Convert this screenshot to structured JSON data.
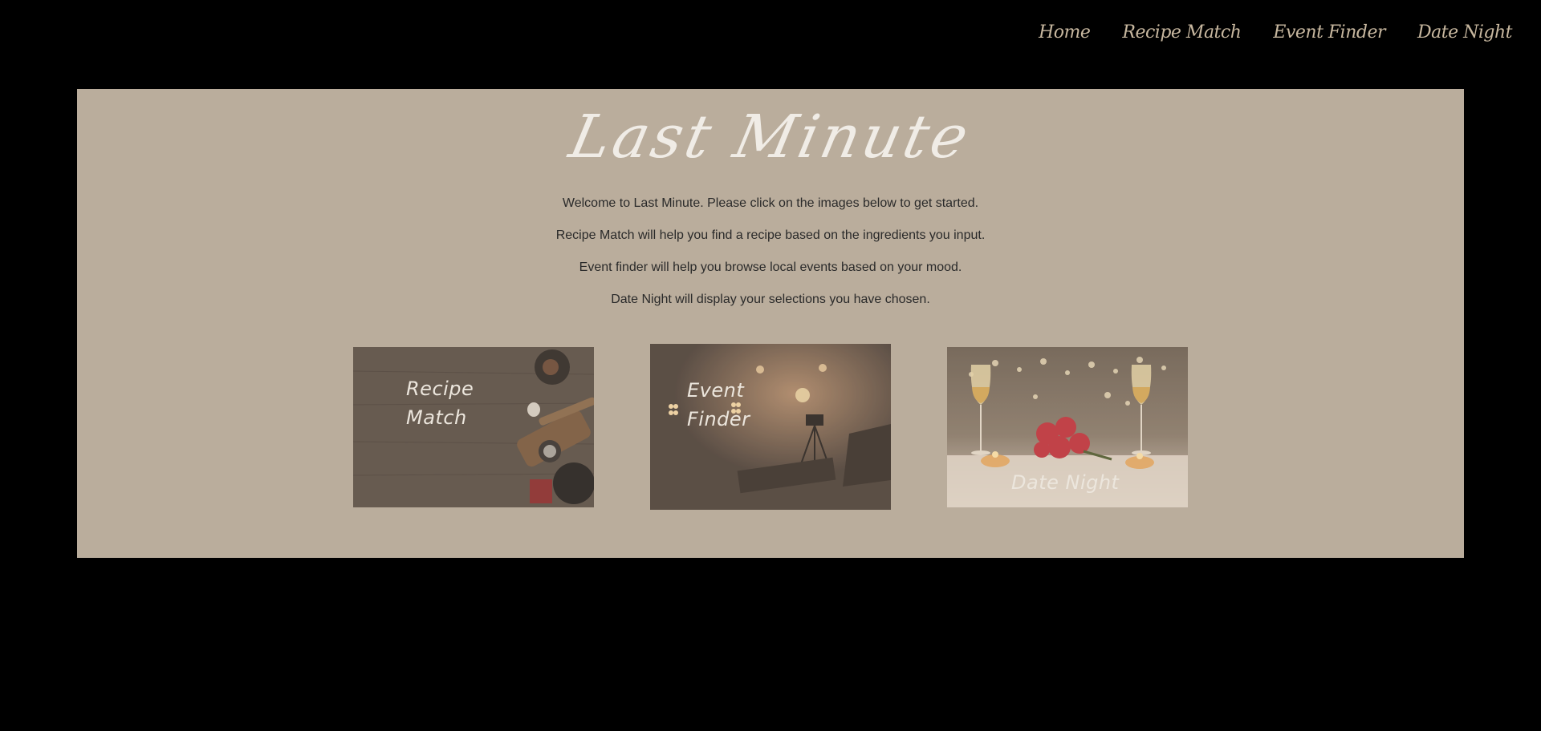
{
  "nav": {
    "items": [
      {
        "label": "Home"
      },
      {
        "label": "Recipe Match"
      },
      {
        "label": "Event Finder"
      },
      {
        "label": "Date Night"
      }
    ]
  },
  "main": {
    "title": "Last Minute",
    "paragraphs": [
      "Welcome to Last Minute. Please click on the images below to get started.",
      "Recipe Match will help you find a recipe based on the ingredients you input.",
      "Event finder will help you browse local events based on your mood.",
      "Date Night will display your selections you have chosen."
    ],
    "tiles": [
      {
        "line1": "Recipe",
        "line2": "Match"
      },
      {
        "line1": "Event",
        "line2": "Finder"
      },
      {
        "label": "Date Night"
      }
    ]
  },
  "colors": {
    "background": "#000000",
    "panel": "#baad9c",
    "nav_text": "#c7b79f",
    "title_text": "#f0ece6",
    "body_text": "#2a2a2a"
  }
}
